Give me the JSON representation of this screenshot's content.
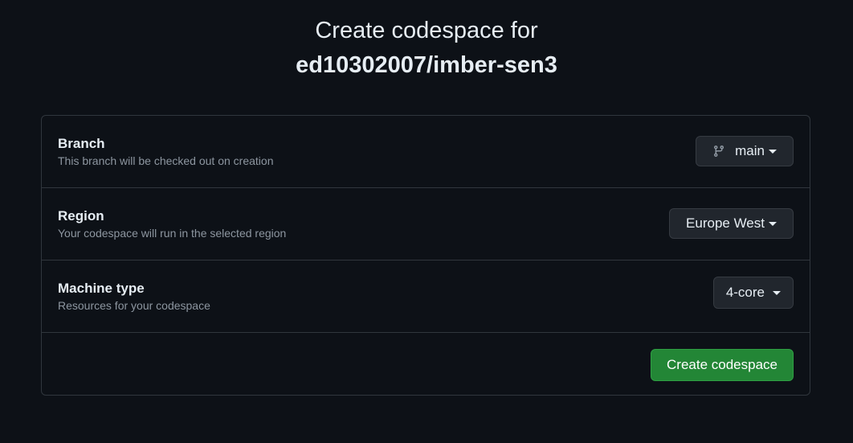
{
  "header": {
    "title_line1": "Create codespace for",
    "title_line2": "ed10302007/imber-sen3"
  },
  "branch": {
    "title": "Branch",
    "description": "This branch will be checked out on creation",
    "selected": "main",
    "icon": "git-branch-icon"
  },
  "region": {
    "title": "Region",
    "description": "Your codespace will run in the selected region",
    "selected": "Europe West"
  },
  "machine": {
    "title": "Machine type",
    "description": "Resources for your codespace",
    "selected": "4-core"
  },
  "actions": {
    "create_label": "Create codespace"
  },
  "colors": {
    "background": "#0d1117",
    "border": "#30363d",
    "primary_button": "#238636",
    "muted_text": "#8d96a0"
  }
}
